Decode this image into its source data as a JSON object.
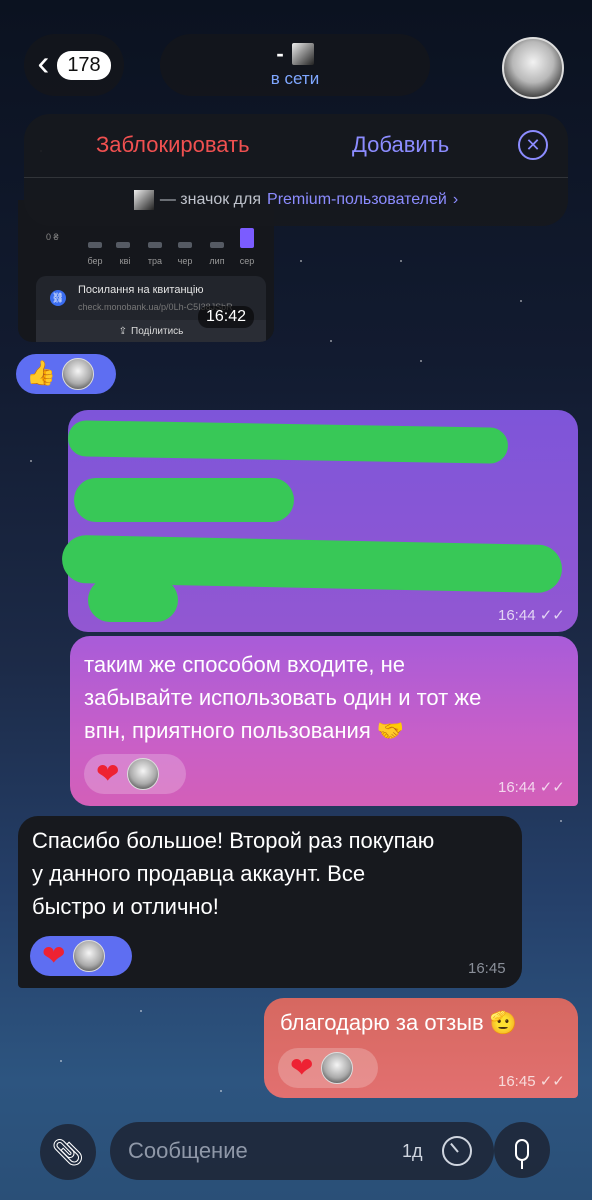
{
  "header": {
    "back_count": "178",
    "back_icon": "chevron-left",
    "contact_name": "-",
    "status": "в сети"
  },
  "action_panel": {
    "block_label": "Заблокировать",
    "add_label": "Добавить",
    "close_icon": "circle-x",
    "premium_text": "— значок для",
    "premium_link": "Premium-пользователей",
    "premium_chevron": "›"
  },
  "screenshot_message": {
    "chart_zero": "0 ₴",
    "months": [
      "бер",
      "кві",
      "тра",
      "чер",
      "лип",
      "сер"
    ],
    "receipt_title": "Посилання на квитанцію",
    "receipt_url": "check.monobank.ua/p/0Lh-C5I38JSbR",
    "share_label": "Поділитись",
    "time": "16:42",
    "reactions": {
      "emoji": "👍"
    }
  },
  "messages": [
    {
      "id": "redacted",
      "direction": "out",
      "time": "16:44",
      "status": "✓✓"
    },
    {
      "id": "vpn-tip",
      "direction": "out",
      "text_lines": [
        "таким же способом входите, не",
        "забывайте использовать один и тот же",
        "впн, приятного пользования 🤝"
      ],
      "time": "16:44",
      "status": "✓✓",
      "reaction": "❤"
    },
    {
      "id": "thanks",
      "direction": "in",
      "text_lines": [
        "Спасибо большое! Второй раз покупаю",
        "у данного продавца аккаунт. Все",
        "быстро и отлично!"
      ],
      "time": "16:45",
      "reaction": "❤"
    },
    {
      "id": "reply",
      "direction": "out",
      "text_lines": [
        "благодарю за отзыв 🫡"
      ],
      "time": "16:45",
      "status": "✓✓",
      "reaction": "❤"
    }
  ],
  "composer": {
    "placeholder": "Сообщение",
    "timer_label": "1д",
    "attach_icon": "paperclip",
    "mic_icon": "microphone"
  },
  "colors": {
    "accent_blue": "#7fa7ff",
    "block_red": "#f05050",
    "add_purple": "#8c8cff",
    "reaction_blue": "#5e6ef2"
  }
}
